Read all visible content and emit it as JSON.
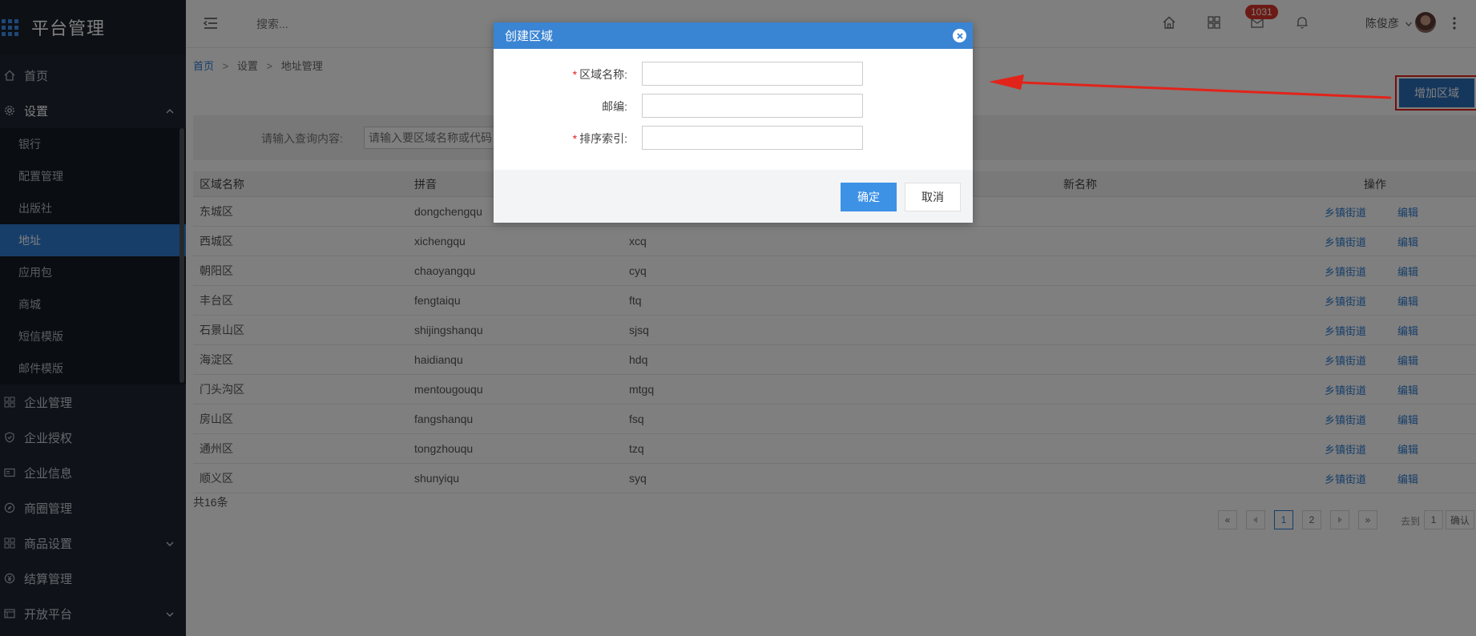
{
  "app": {
    "title": "平台管理"
  },
  "sidebar": {
    "items": [
      {
        "label": "首页",
        "icon": "home-icon"
      },
      {
        "label": "设置",
        "icon": "gear-icon",
        "expanded": true,
        "children": [
          "银行",
          "配置管理",
          "出版社",
          "地址",
          "应用包",
          "商城",
          "短信模版",
          "邮件模版"
        ],
        "active_child": "地址"
      },
      {
        "label": "企业管理",
        "icon": "grid-icon"
      },
      {
        "label": "企业授权",
        "icon": "shield-icon"
      },
      {
        "label": "企业信息",
        "icon": "id-card-icon"
      },
      {
        "label": "商圈管理",
        "icon": "compass-icon"
      },
      {
        "label": "商品设置",
        "icon": "grid-icon",
        "has_submenu": true
      },
      {
        "label": "结算管理",
        "icon": "yen-icon"
      },
      {
        "label": "开放平台",
        "icon": "panel-icon",
        "has_submenu": true
      }
    ]
  },
  "header": {
    "search_placeholder": "搜索...",
    "badge_count": "1031",
    "user_name": "陈俊彦"
  },
  "breadcrumb": [
    "首页",
    ">",
    "设置",
    ">",
    "地址管理"
  ],
  "toolbar": {
    "add_label": "增加区域"
  },
  "filter": {
    "label": "请输入查询内容:",
    "placeholder": "请输入要区域名称或代码"
  },
  "table": {
    "headers": [
      "区域名称",
      "拼音",
      "",
      "新名称",
      "操作"
    ],
    "action_labels": [
      "乡镇街道",
      "编辑"
    ],
    "rows": [
      {
        "name": "东城区",
        "pinyin": "dongchengqu",
        "abbr": ""
      },
      {
        "name": "西城区",
        "pinyin": "xichengqu",
        "abbr": "xcq"
      },
      {
        "name": "朝阳区",
        "pinyin": "chaoyangqu",
        "abbr": "cyq"
      },
      {
        "name": "丰台区",
        "pinyin": "fengtaiqu",
        "abbr": "ftq"
      },
      {
        "name": "石景山区",
        "pinyin": "shijingshanqu",
        "abbr": "sjsq"
      },
      {
        "name": "海淀区",
        "pinyin": "haidianqu",
        "abbr": "hdq"
      },
      {
        "name": "门头沟区",
        "pinyin": "mentougouqu",
        "abbr": "mtgq"
      },
      {
        "name": "房山区",
        "pinyin": "fangshanqu",
        "abbr": "fsq"
      },
      {
        "name": "通州区",
        "pinyin": "tongzhouqu",
        "abbr": "tzq"
      },
      {
        "name": "顺义区",
        "pinyin": "shunyiqu",
        "abbr": "syq"
      }
    ],
    "total": "共16条"
  },
  "pagination": {
    "first": "«",
    "last": "»",
    "pages": [
      "1",
      "2"
    ],
    "current": "1",
    "goto_label": "去到",
    "goto_value": "1",
    "confirm_label": "确认"
  },
  "modal": {
    "title": "创建区域",
    "fields": [
      {
        "label": "区域名称:",
        "required": true,
        "value": ""
      },
      {
        "label": "邮编:",
        "required": false,
        "value": ""
      },
      {
        "label": "排序索引:",
        "required": true,
        "value": ""
      }
    ],
    "ok_label": "确定",
    "cancel_label": "取消"
  },
  "colors": {
    "sidebar_bg": "#1e2530",
    "active_blue": "#2d7dd2",
    "header_blue": "#3a84d4",
    "badge_red": "#d9342b",
    "annotation_red": "#e2231a"
  }
}
